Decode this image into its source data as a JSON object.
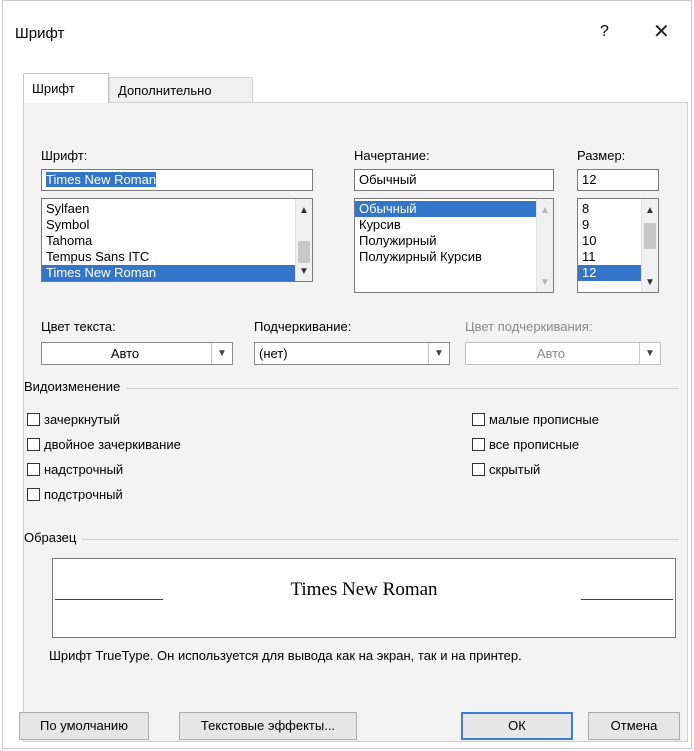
{
  "window": {
    "title": "Шрифт",
    "help": "?",
    "close": "✕"
  },
  "tabs": [
    {
      "label": "Шрифт"
    },
    {
      "label": "Дополнительно"
    }
  ],
  "font": {
    "label": "Шрифт:",
    "value": "Times New Roman",
    "items": [
      "Sylfaen",
      "Symbol",
      "Tahoma",
      "Tempus Sans ITC",
      "Times New Roman"
    ],
    "selected": "Times New Roman"
  },
  "style": {
    "label": "Начертание:",
    "value": "Обычный",
    "items": [
      "Обычный",
      "Курсив",
      "Полужирный",
      "Полужирный Курсив"
    ],
    "selected": "Обычный"
  },
  "size": {
    "label": "Размер:",
    "value": "12",
    "items": [
      "8",
      "9",
      "10",
      "11",
      "12"
    ],
    "selected": "12"
  },
  "text_color": {
    "label": "Цвет текста:",
    "value": "Авто"
  },
  "underline": {
    "label": "Подчеркивание:",
    "value": "(нет)"
  },
  "underline_color": {
    "label": "Цвет подчеркивания:",
    "value": "Авто"
  },
  "effects": {
    "title": "Видоизменение",
    "left": [
      "зачеркнутый",
      "двойное зачеркивание",
      "надстрочный",
      "подстрочный"
    ],
    "right": [
      "малые прописные",
      "все прописные",
      "скрытый"
    ]
  },
  "preview": {
    "title": "Образец",
    "sample": "Times New Roman",
    "description": "Шрифт TrueType. Он используется для вывода как на экран, так и на принтер."
  },
  "buttons": {
    "default": "По умолчанию",
    "effects": "Текстовые эффекты...",
    "ok": "ОК",
    "cancel": "Отмена"
  },
  "colors": {
    "accent": "#3375c8",
    "panel": "#f3f3f3"
  }
}
